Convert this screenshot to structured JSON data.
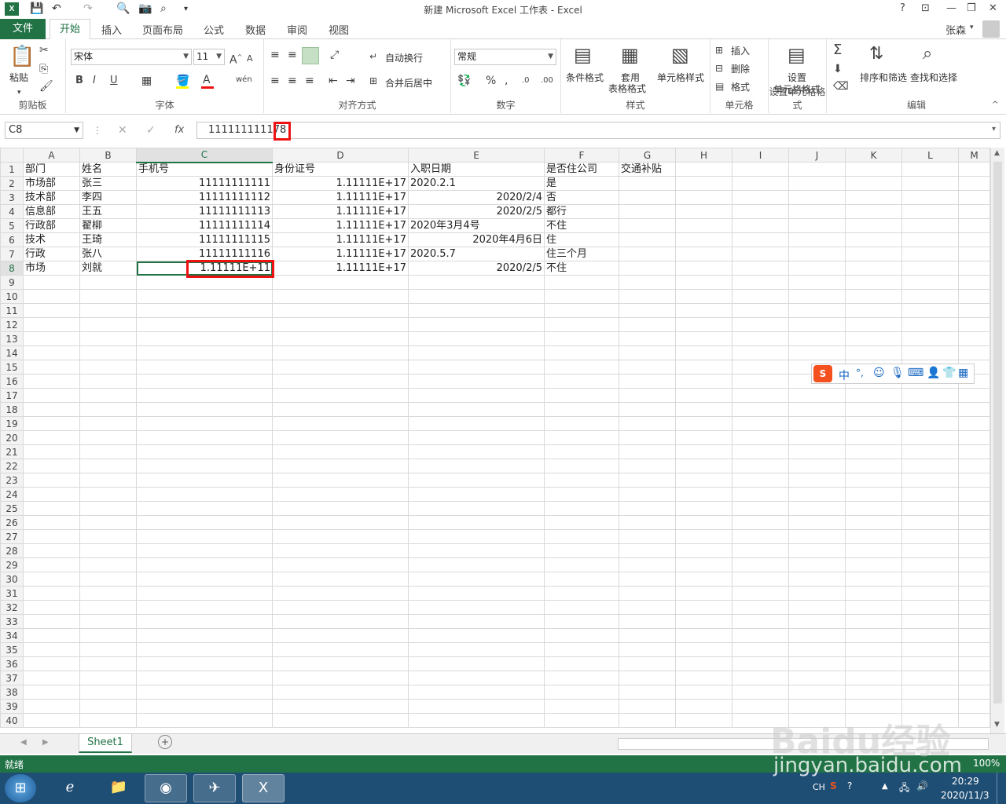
{
  "window": {
    "title": "新建 Microsoft Excel 工作表 - Excel",
    "app_icon": "X",
    "controls": [
      "?",
      "⊡",
      "—",
      "❐",
      "✕"
    ]
  },
  "tabs": {
    "file": "文件",
    "home": "开始",
    "items": [
      "插入",
      "页面布局",
      "公式",
      "数据",
      "审阅",
      "视图"
    ],
    "user": "张森"
  },
  "ribbon": {
    "clipboard": {
      "paste": "粘贴",
      "label": "剪贴板"
    },
    "font": {
      "name": "宋体",
      "size": "11",
      "label": "字体",
      "bold": "B",
      "italic": "I",
      "underline": "U"
    },
    "alignment": {
      "wrap": "自动换行",
      "merge": "合并后居中",
      "label": "对齐方式"
    },
    "number": {
      "format": "常规",
      "label": "数字"
    },
    "styles": {
      "conditional": "条件格式",
      "table1": "套用",
      "table2": "表格格式",
      "cell": "单元格样式",
      "label": "样式"
    },
    "cells": {
      "insert": "插入",
      "delete": "删除",
      "format": "格式",
      "label": "单元格"
    },
    "setfmt": {
      "l1": "设置",
      "l2": "单元格格式",
      "label": "设置单元格格式"
    },
    "editing": {
      "sort": "排序和筛选",
      "find": "查找和选择",
      "label": "编辑"
    }
  },
  "formula_bar": {
    "name_box": "C8",
    "fx": "fx",
    "value": "111111111178"
  },
  "grid": {
    "columns": [
      "A",
      "B",
      "C",
      "D",
      "E",
      "F",
      "G",
      "H",
      "I",
      "J",
      "K",
      "L",
      "M"
    ],
    "rows": [
      [
        "部门",
        "姓名",
        "手机号",
        "身份证号",
        "入职日期",
        "是否住公司",
        "交通补贴"
      ],
      [
        "市场部",
        "张三",
        "11111111111",
        "1.11111E+17",
        "2020.2.1",
        "是",
        ""
      ],
      [
        "技术部",
        "李四",
        "11111111112",
        "1.11111E+17",
        "2020/2/4",
        "否",
        ""
      ],
      [
        "信息部",
        "王五",
        "11111111113",
        "1.11111E+17",
        "2020/2/5",
        "都行",
        ""
      ],
      [
        "行政部",
        "翟柳",
        "11111111114",
        "1.11111E+17",
        "2020年3月4号",
        "不住",
        ""
      ],
      [
        "技术",
        "王琦",
        "11111111115",
        "1.11111E+17",
        "2020年4月6日",
        "住",
        ""
      ],
      [
        "行政",
        "张八",
        "11111111116",
        "1.11111E+17",
        "2020.5.7",
        "住三个月",
        ""
      ],
      [
        "市场",
        "刘就",
        "1.11111E+11",
        "1.11111E+17",
        "2020/2/5",
        "不住",
        ""
      ]
    ],
    "total_rows": 40,
    "active_cell": "C8"
  },
  "sheet_tabs": {
    "active": "Sheet1",
    "add": "+"
  },
  "status": {
    "ready": "就绪",
    "zoom": "100%"
  },
  "taskbar": {
    "lang": "CH",
    "time": "20:29",
    "date": "2020/11/3"
  },
  "watermark": {
    "brand": "Baidu经验",
    "url": "jingyan.baidu.com"
  }
}
